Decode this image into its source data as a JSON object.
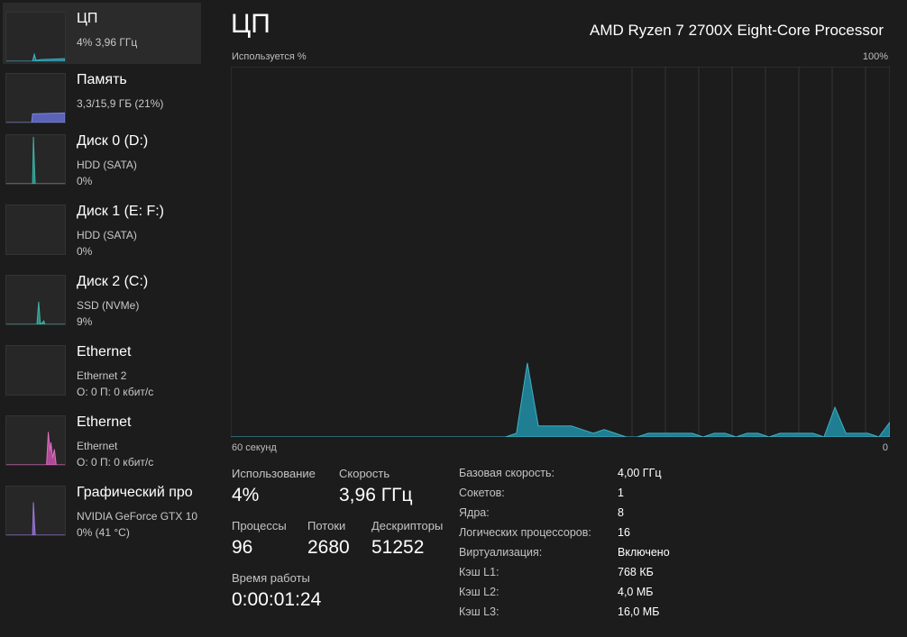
{
  "sidebar": {
    "items": [
      {
        "title": "ЦП",
        "sub1": "4%  3,96 ГГц",
        "sub2": "",
        "color": "#41b5c8",
        "selected": true
      },
      {
        "title": "Память",
        "sub1": "3,3/15,9 ГБ (21%)",
        "sub2": "",
        "color": "#7b86e0",
        "selected": false
      },
      {
        "title": "Диск 0 (D:)",
        "sub1": "HDD (SATA)",
        "sub2": "0%",
        "color": "#3fb5a8",
        "selected": false
      },
      {
        "title": "Диск 1 (E: F:)",
        "sub1": "HDD (SATA)",
        "sub2": "0%",
        "color": "#3fb5a8",
        "selected": false
      },
      {
        "title": "Диск 2 (C:)",
        "sub1": "SSD (NVMe)",
        "sub2": "9%",
        "color": "#3fb5a8",
        "selected": false
      },
      {
        "title": "Ethernet",
        "sub1": "Ethernet 2",
        "sub2": "О: 0 П: 0 кбит/с",
        "color": "#d060b0",
        "selected": false
      },
      {
        "title": "Ethernet",
        "sub1": "Ethernet",
        "sub2": "О: 0 П: 0 кбит/с",
        "color": "#e070c0",
        "selected": false
      },
      {
        "title": "Графический про",
        "sub1": "NVIDIA GeForce GTX 10",
        "sub2": "0%  (41 °C)",
        "color": "#9b7ad8",
        "selected": false
      }
    ]
  },
  "main": {
    "title": "ЦП",
    "cpu_model": "AMD Ryzen 7 2700X Eight-Core Processor",
    "graph": {
      "y_label": "Используется %",
      "y_max_label": "100%",
      "x_left_label": "60 секунд",
      "x_right_label": "0",
      "line_color": "#3fb0c4",
      "fill_color": "#1f7e92",
      "values": [
        0,
        0,
        0,
        0,
        0,
        0,
        0,
        0,
        0,
        0,
        0,
        0,
        0,
        0,
        0,
        0,
        0,
        0,
        0,
        0,
        0,
        0,
        0,
        0,
        0,
        0,
        1,
        20,
        3,
        3,
        3,
        3,
        2,
        1,
        2,
        1,
        0,
        0,
        1,
        1,
        1,
        1,
        1,
        0,
        1,
        1,
        0,
        1,
        1,
        0,
        1,
        1,
        1,
        1,
        0,
        8,
        1,
        1,
        1,
        0,
        4
      ]
    }
  },
  "stats": {
    "usage_label": "Использование",
    "usage_value": "4%",
    "speed_label": "Скорость",
    "speed_value": "3,96 ГГц",
    "processes_label": "Процессы",
    "processes_value": "96",
    "threads_label": "Потоки",
    "threads_value": "2680",
    "handles_label": "Дескрипторы",
    "handles_value": "51252",
    "uptime_label": "Время работы",
    "uptime_value": "0:00:01:24"
  },
  "specs": [
    {
      "label": "Базовая скорость:",
      "value": "4,00 ГГц"
    },
    {
      "label": "Сокетов:",
      "value": "1"
    },
    {
      "label": "Ядра:",
      "value": "8"
    },
    {
      "label": "Логических процессоров:",
      "value": "16"
    },
    {
      "label": "Виртуализация:",
      "value": "Включено"
    },
    {
      "label": "Кэш L1:",
      "value": "768 КБ"
    },
    {
      "label": "Кэш L2:",
      "value": "4,0 МБ"
    },
    {
      "label": "Кэш L3:",
      "value": "16,0 МБ"
    }
  ]
}
